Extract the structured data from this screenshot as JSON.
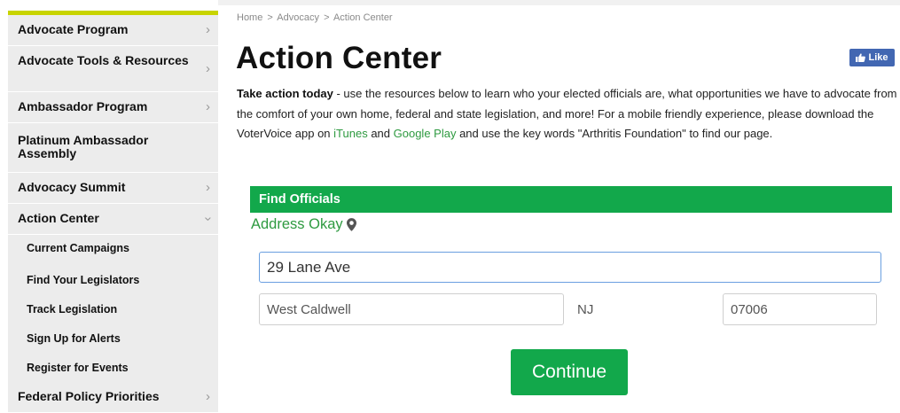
{
  "breadcrumb": {
    "home": "Home",
    "sep": ">",
    "advocacy": "Advocacy",
    "current": "Action Center"
  },
  "page_title": "Action Center",
  "like_button": {
    "label": "Like",
    "icon": "thumbs-up-icon",
    "color": "#4267b2"
  },
  "intro": {
    "lead": "Take action today",
    "text1": " - use the resources below to learn who your elected officials are, what opportunities we have to advocate from the comfort of your own home, federal and state legislation, and more! For a mobile friendly experience, please download the VoterVoice app on ",
    "link1": "iTunes",
    "and": " and ",
    "link2": "Google Play",
    "text2": " and use the key words \"Arthritis Foundation\" to find our page."
  },
  "sidebar": {
    "accent_color": "#c8d400",
    "items": [
      {
        "label": "Advocate Program",
        "chevron": "›"
      },
      {
        "label": "Advocate Tools & Resources",
        "chevron": "›"
      },
      {
        "label": "Ambassador Program",
        "chevron": "›"
      },
      {
        "label": "Platinum Ambassador Assembly",
        "chevron": ""
      },
      {
        "label": "Advocacy Summit",
        "chevron": "›"
      },
      {
        "label": "Action Center",
        "chevron": "›",
        "expanded": true
      },
      {
        "label": "Federal Policy Priorities",
        "chevron": "›"
      }
    ],
    "subitems": [
      {
        "label": "Current Campaigns"
      },
      {
        "label": "Find Your Legislators"
      },
      {
        "label": "Track Legislation"
      },
      {
        "label": "Sign Up for Alerts"
      },
      {
        "label": "Register for Events"
      }
    ]
  },
  "find_officials": {
    "header": "Find Officials",
    "header_color": "#12a84b",
    "status": "Address Okay",
    "status_icon": "map-pin-icon",
    "street": {
      "value": "29 Lane Ave"
    },
    "city": {
      "value": "West Caldwell"
    },
    "state": "NJ",
    "zip": {
      "value": "07006"
    },
    "continue_label": "Continue"
  }
}
